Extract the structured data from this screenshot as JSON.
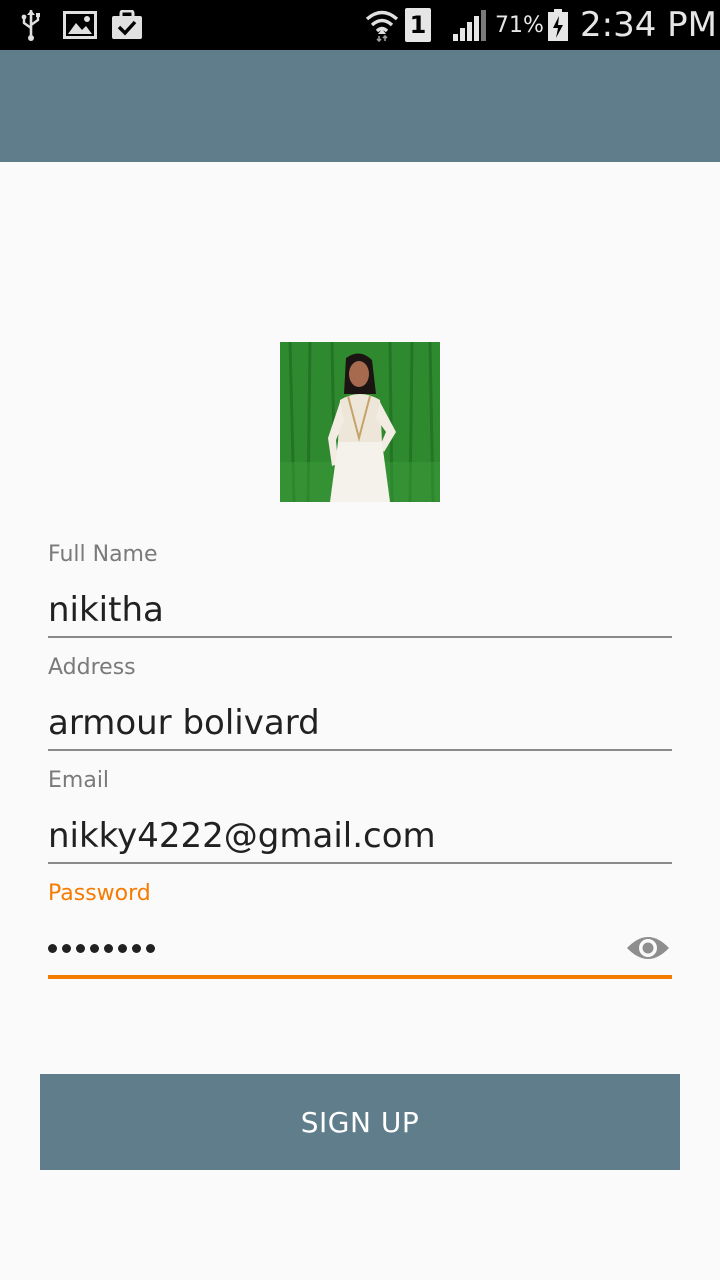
{
  "status_bar": {
    "icons": [
      "usb-icon",
      "gallery-icon",
      "clipboard-check-icon",
      "wifi-icon",
      "sim-1-icon",
      "signal-icon",
      "battery-charging-icon"
    ],
    "sim_number": "1",
    "battery_percent": "71%",
    "time": "2:34 PM"
  },
  "app_bar": {
    "color": "#607d8b"
  },
  "avatar": {
    "icon": "profile-photo"
  },
  "form": {
    "full_name": {
      "label": "Full Name",
      "value": "nikitha"
    },
    "address": {
      "label": "Address",
      "value": "armour bolivard"
    },
    "email": {
      "label": "Email",
      "value": "nikky4222@gmail.com"
    },
    "password": {
      "label": "Password",
      "masked_length": 8,
      "toggle_icon": "eye-icon"
    }
  },
  "signup_button": {
    "label": "SIGN UP"
  },
  "colors": {
    "accent": "#f57c00",
    "primary": "#607d8b",
    "background": "#fafafa"
  }
}
